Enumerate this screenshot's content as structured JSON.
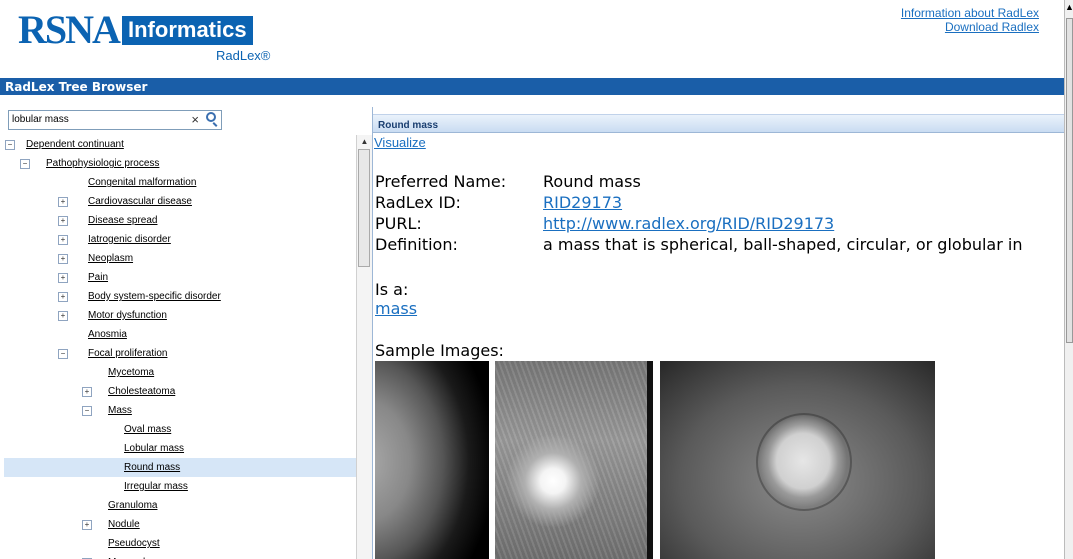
{
  "header": {
    "logo_main": "RSNA",
    "logo_badge": "Informatics",
    "logo_sub": "RadLex®",
    "link_info": "Information about RadLex",
    "link_download": "Download Radlex"
  },
  "titlebar": {
    "title": "RadLex Tree Browser"
  },
  "search": {
    "value": "lobular mass",
    "clear": "×"
  },
  "tree": {
    "items": [
      {
        "label": "Dependent continuant",
        "toggle": "⊟"
      },
      {
        "label": "Pathophysiologic process",
        "toggle": "⊟"
      },
      {
        "label": "Congenital malformation",
        "toggle": ""
      },
      {
        "label": "Cardiovascular disease",
        "toggle": "⊞"
      },
      {
        "label": "Disease spread",
        "toggle": "⊞"
      },
      {
        "label": "Iatrogenic disorder",
        "toggle": "⊞"
      },
      {
        "label": "Neoplasm",
        "toggle": "⊞"
      },
      {
        "label": "Pain",
        "toggle": "⊞"
      },
      {
        "label": "Body system-specific disorder",
        "toggle": "⊞"
      },
      {
        "label": "Motor dysfunction",
        "toggle": "⊞"
      },
      {
        "label": "Anosmia",
        "toggle": ""
      },
      {
        "label": "Focal proliferation",
        "toggle": "⊟"
      },
      {
        "label": "Mycetoma",
        "toggle": ""
      },
      {
        "label": "Cholesteatoma",
        "toggle": "⊞"
      },
      {
        "label": "Mass",
        "toggle": "⊟"
      },
      {
        "label": "Oval mass",
        "toggle": ""
      },
      {
        "label": "Lobular mass",
        "toggle": ""
      },
      {
        "label": "Round mass",
        "toggle": "",
        "selected": true
      },
      {
        "label": "Irregular mass",
        "toggle": ""
      },
      {
        "label": "Granuloma",
        "toggle": ""
      },
      {
        "label": "Nodule",
        "toggle": "⊞"
      },
      {
        "label": "Pseudocyst",
        "toggle": ""
      },
      {
        "label": "Mucocele",
        "toggle": "⊞"
      }
    ]
  },
  "detail": {
    "header": "Round mass",
    "visualize": "Visualize",
    "preferred_name_label": "Preferred Name:",
    "preferred_name": "Round mass",
    "radlex_id_label": "RadLex ID:",
    "radlex_id": "RID29173",
    "purl_label": "PURL:",
    "purl": "http://www.radlex.org/RID/RID29173",
    "definition_label": "Definition:",
    "definition": "a mass that is spherical, ball-shaped, circular, or globular in",
    "isa_label": "Is a:",
    "isa_link": "mass",
    "samples_label": "Sample Images:"
  }
}
